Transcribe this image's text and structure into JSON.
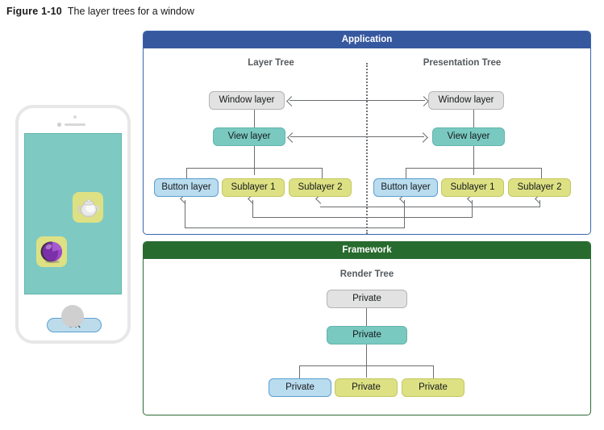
{
  "figure": {
    "label": "Figure 1-10",
    "title": "The layer trees for a window"
  },
  "colors": {
    "application_header": "#36589f",
    "application_border": "#3b64ac",
    "framework_header": "#276b2e",
    "framework_border": "#2d6b33",
    "node_gray": "#e2e2e2",
    "node_teal": "#79c9c1",
    "node_blue": "#b9dcef",
    "node_yellow": "#dde183",
    "connector": "#6a6e71",
    "phone_screen": "#7ecac3"
  },
  "panels": {
    "application": {
      "title": "Application",
      "trees": [
        {
          "title": "Layer Tree",
          "nodes": {
            "root": "Window layer",
            "view": "View layer",
            "children": [
              "Button layer",
              "Sublayer 1",
              "Sublayer 2"
            ]
          }
        },
        {
          "title": "Presentation Tree",
          "nodes": {
            "root": "Window layer",
            "view": "View layer",
            "children": [
              "Button layer",
              "Sublayer 1",
              "Sublayer 2"
            ]
          }
        }
      ]
    },
    "framework": {
      "title": "Framework",
      "tree": {
        "title": "Render Tree",
        "nodes": {
          "root": "Private",
          "view": "Private",
          "children": [
            "Private",
            "Private",
            "Private"
          ]
        }
      }
    }
  },
  "device": {
    "ok_button": "OK",
    "tiles": [
      {
        "icon": "teapot-icon"
      },
      {
        "icon": "sphere-icon"
      }
    ]
  }
}
